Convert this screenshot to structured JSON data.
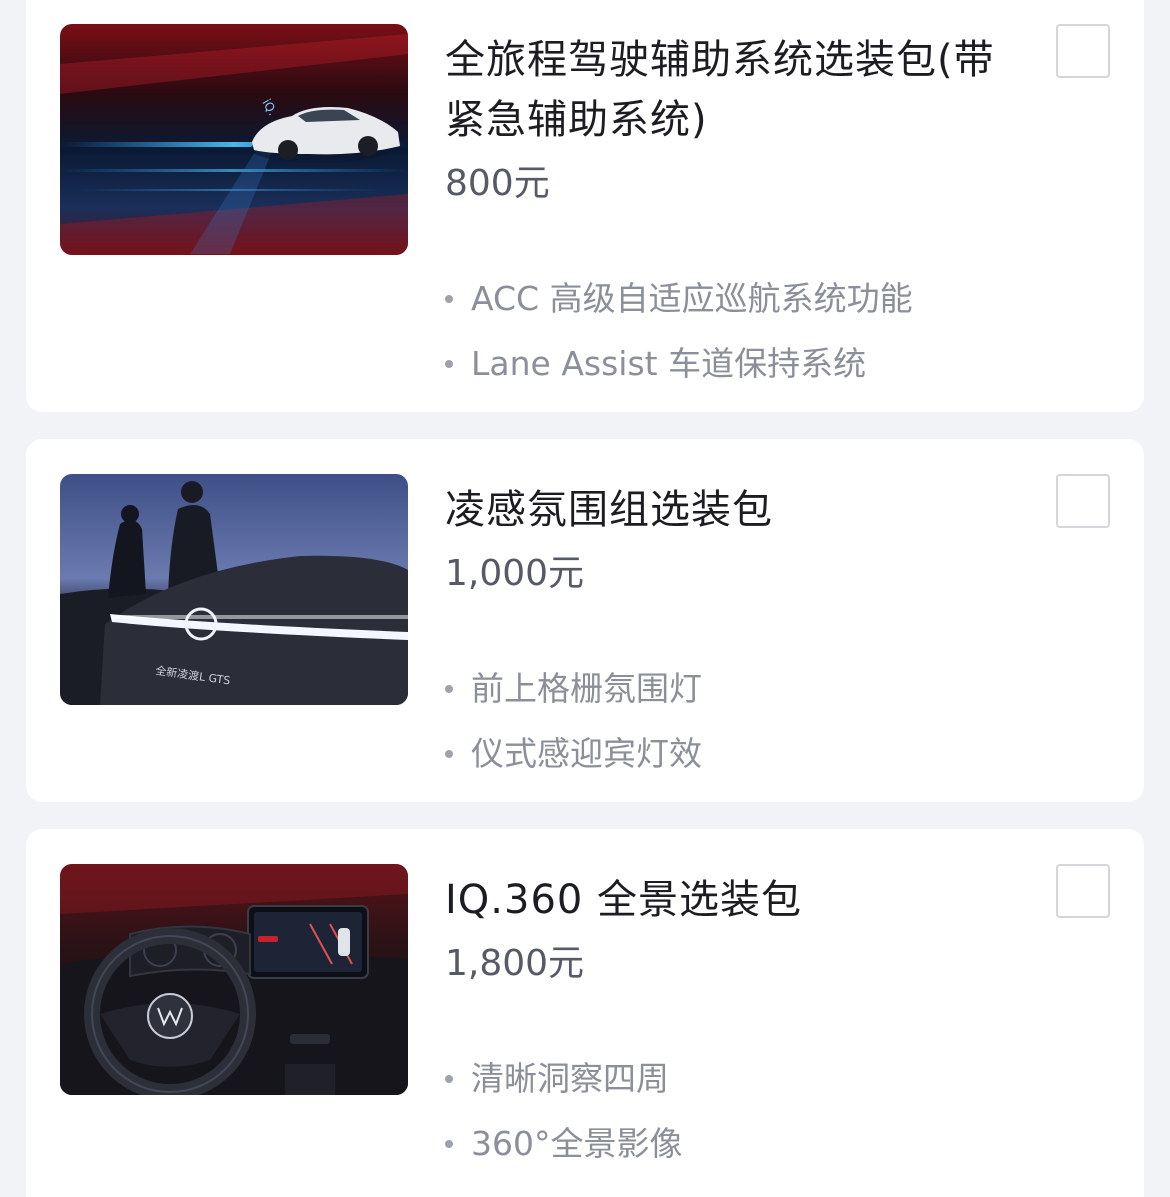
{
  "packages": [
    {
      "title": "全旅程驾驶辅助系统选装包(带紧急辅助系统)",
      "price": "800元",
      "features": [
        "ACC 高级自适应巡航系统功能",
        "Lane Assist 车道保持系统"
      ],
      "image_icon": "driver-assist-package-image",
      "checked": false
    },
    {
      "title": "凌感氛围组选装包",
      "price": "1,000元",
      "features": [
        "前上格栅氛围灯",
        "仪式感迎宾灯效"
      ],
      "image_icon": "ambient-light-package-image",
      "image_caption": "全新凌渡L GTS",
      "checked": false
    },
    {
      "title": "IQ.360 全景选装包",
      "price": "1,800元",
      "features": [
        "清晰洞察四周",
        "360°全景影像"
      ],
      "image_icon": "iq360-package-image",
      "checked": false
    }
  ],
  "colors": {
    "background": "#f2f3f6",
    "card": "#ffffff",
    "title": "#1c1d22",
    "price": "#555a66",
    "feature": "#8b8f99",
    "checkbox_border": "#d4d6db"
  }
}
